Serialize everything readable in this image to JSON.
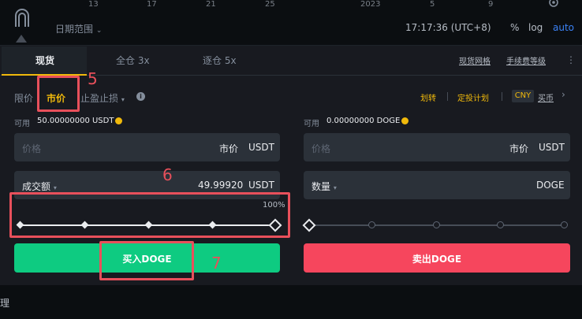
{
  "chart": {
    "axis_ticks": [
      "13",
      "17",
      "21",
      "25",
      "2023",
      "5",
      "9"
    ],
    "date_range_label": "日期范围",
    "time": "17:17:36 (UTC+8)",
    "tools": [
      "%",
      "log",
      "auto"
    ],
    "auto_color": "#3b82f6"
  },
  "tabs": [
    {
      "label": "现货",
      "active": true
    },
    {
      "label": "全仓 3x",
      "active": false
    },
    {
      "label": "逐仓 5x",
      "active": false
    }
  ],
  "top_links": [
    "现货网格",
    "手续费等级"
  ],
  "order_types": [
    {
      "label": "限价",
      "active": false
    },
    {
      "label": "市价",
      "active": true
    },
    {
      "label": "止盈止损",
      "active": false
    }
  ],
  "right_links": [
    "划转",
    "定投计划"
  ],
  "currency_badge": "CNY",
  "currency_link": "买币",
  "buy_side": {
    "available_label": "可用",
    "available_value": "50.00000000 USDT",
    "price_placeholder": "价格",
    "price_value": "市价",
    "price_unit": "USDT",
    "amount_label": "成交额",
    "amount_value": "49.99920",
    "amount_unit": "USDT",
    "slider_percent_label": "100%",
    "slider_percent": 100,
    "button_label": "买入DOGE"
  },
  "sell_side": {
    "available_label": "可用",
    "available_value": "0.00000000 DOGE",
    "price_placeholder": "价格",
    "price_value": "市价",
    "price_unit": "USDT",
    "amount_label": "数量",
    "amount_unit": "DOGE",
    "slider_percent": 0,
    "button_label": "卖出DOGE"
  },
  "bottom_label": "理",
  "annotations": [
    "5",
    "6",
    "7"
  ],
  "colors": {
    "accent": "#f0b90b",
    "buy": "#0ecb81",
    "sell": "#f6465d",
    "highlight": "#e8505b"
  }
}
